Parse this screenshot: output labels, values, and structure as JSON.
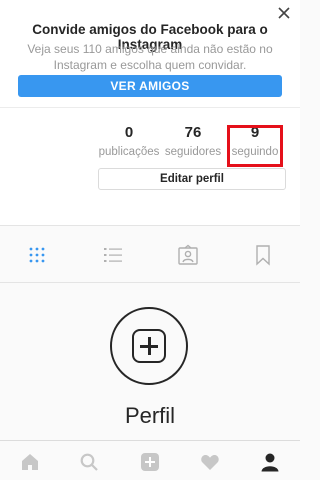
{
  "banner": {
    "title": "Convide amigos do Facebook para o Instagram",
    "text": "Veja seus 110 amigos que ainda não estão no Instagram e escolha quem convidar.",
    "button_label": "VER AMIGOS",
    "close_icon": "close-icon"
  },
  "profile": {
    "stats": {
      "posts": {
        "value": "0",
        "label": "publicações"
      },
      "followers": {
        "value": "76",
        "label": "seguidores"
      },
      "following": {
        "value": "9",
        "label": "seguindo"
      }
    },
    "edit_button_label": "Editar perfil",
    "highlight_color": "#e5101a"
  },
  "view_tabs": [
    {
      "icon": "grid-icon",
      "active": true
    },
    {
      "icon": "list-icon",
      "active": false
    },
    {
      "icon": "tagged-photos-icon",
      "active": false
    },
    {
      "icon": "bookmark-icon",
      "active": false
    }
  ],
  "empty_state": {
    "icon": "add-photo-icon",
    "title": "Perfil"
  },
  "bottom_nav": [
    {
      "icon": "home-icon"
    },
    {
      "icon": "search-icon"
    },
    {
      "icon": "add-post-icon"
    },
    {
      "icon": "heart-icon"
    },
    {
      "icon": "profile-icon",
      "active": true
    }
  ],
  "colors": {
    "accent": "#3897f0",
    "text": "#262626",
    "muted": "#999999",
    "inactive_icon": "#c7c7c7"
  }
}
